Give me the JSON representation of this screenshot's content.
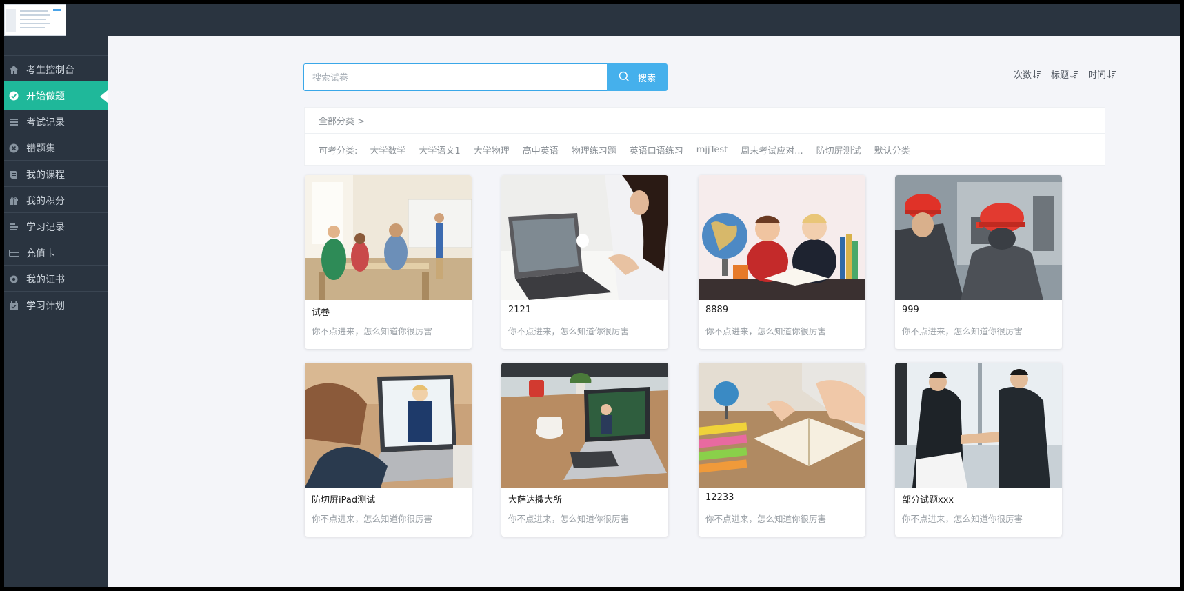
{
  "sidebar": {
    "items": [
      {
        "label": "考生控制台",
        "icon": "home-icon",
        "active": false
      },
      {
        "label": "开始做题",
        "icon": "check-circle-icon",
        "active": true
      },
      {
        "label": "考试记录",
        "icon": "list-icon",
        "active": false
      },
      {
        "label": "错题集",
        "icon": "close-circle-icon",
        "active": false
      },
      {
        "label": "我的课程",
        "icon": "book-icon",
        "active": false
      },
      {
        "label": "我的积分",
        "icon": "gift-icon",
        "active": false
      },
      {
        "label": "学习记录",
        "icon": "lines-icon",
        "active": false
      },
      {
        "label": "充值卡",
        "icon": "card-icon",
        "active": false
      },
      {
        "label": "我的证书",
        "icon": "badge-icon",
        "active": false
      },
      {
        "label": "学习计划",
        "icon": "calendar-icon",
        "active": false
      }
    ]
  },
  "search": {
    "placeholder": "搜索试卷",
    "button_label": "搜索"
  },
  "sort": {
    "items": [
      {
        "label": "次数"
      },
      {
        "label": "标题"
      },
      {
        "label": "时间"
      }
    ]
  },
  "categories": {
    "all_label": "全部分类 >",
    "available_label": "可考分类:",
    "items": [
      "大学数学",
      "大学语文1",
      "大学物理",
      "高中英语",
      "物理练习题",
      "英语口语练习",
      "mjjTest",
      "周末考试应对...",
      "防切屏测试",
      "默认分类"
    ]
  },
  "cards": [
    {
      "title": "试卷",
      "desc": "你不点进来，怎么知道你很厉害",
      "image": "classroom"
    },
    {
      "title": "2121",
      "desc": "你不点进来，怎么知道你很厉害",
      "image": "laptop-woman"
    },
    {
      "title": "8889",
      "desc": "你不点进来，怎么知道你很厉害",
      "image": "kids-globe"
    },
    {
      "title": "999",
      "desc": "你不点进来，怎么知道你很厉害",
      "image": "hardhat-workers"
    },
    {
      "title": "防切屏iPad测试",
      "desc": "你不点进来，怎么知道你很厉害",
      "image": "video-call"
    },
    {
      "title": "大萨达撒大所",
      "desc": "你不点进来，怎么知道你很厉害",
      "image": "laptop-desk"
    },
    {
      "title": "12233",
      "desc": "你不点进来，怎么知道你很厉害",
      "image": "books-study"
    },
    {
      "title": "部分试题xxx",
      "desc": "你不点进来，怎么知道你很厉害",
      "image": "handshake"
    }
  ],
  "colors": {
    "sidebar_bg": "#2a3440",
    "active_bg": "#1fb89a",
    "main_bg": "#f4f5f9",
    "accent": "#45b0ec"
  }
}
